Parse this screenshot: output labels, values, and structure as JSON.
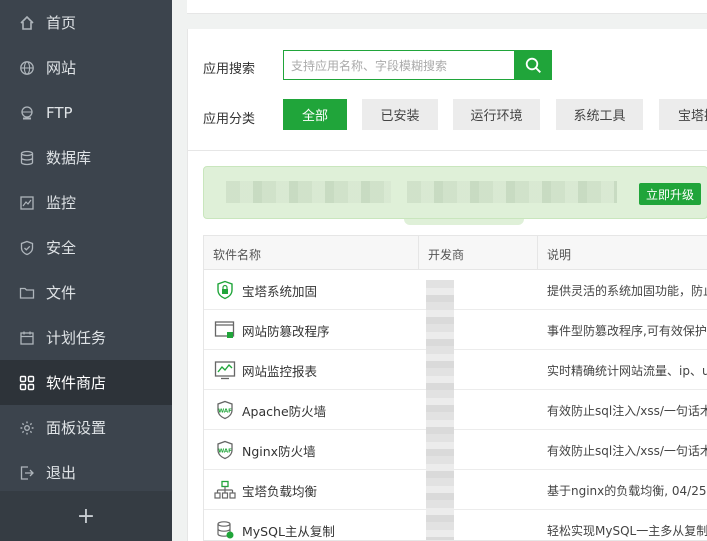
{
  "sidebar": {
    "items": [
      {
        "label": "首页",
        "icon": "home-icon"
      },
      {
        "label": "网站",
        "icon": "globe-icon"
      },
      {
        "label": "FTP",
        "icon": "ftp-icon"
      },
      {
        "label": "数据库",
        "icon": "database-icon"
      },
      {
        "label": "监控",
        "icon": "monitor-icon"
      },
      {
        "label": "安全",
        "icon": "shield-icon"
      },
      {
        "label": "文件",
        "icon": "folder-icon"
      },
      {
        "label": "计划任务",
        "icon": "schedule-icon"
      },
      {
        "label": "软件商店",
        "icon": "grid-icon"
      },
      {
        "label": "面板设置",
        "icon": "gear-icon"
      },
      {
        "label": "退出",
        "icon": "logout-icon"
      }
    ],
    "active_index": 8,
    "add_label": "+"
  },
  "search": {
    "label": "应用搜索",
    "placeholder": "支持应用名称、字段模糊搜索"
  },
  "categories": {
    "label": "应用分类",
    "items": [
      "全部",
      "已安装",
      "运行环境",
      "系统工具",
      "宝塔插"
    ],
    "active_index": 0
  },
  "banner": {
    "upgrade_label": "立即升级"
  },
  "table": {
    "headers": [
      "软件名称",
      "开发商",
      "说明"
    ],
    "rows": [
      {
        "name": "宝塔系统加固",
        "icon": "lock-shield-icon",
        "desc": "提供灵活的系统加固功能，防止"
      },
      {
        "name": "网站防篡改程序",
        "icon": "web-lock-icon",
        "desc": "事件型防篡改程序,可有效保护"
      },
      {
        "name": "网站监控报表",
        "icon": "chart-report-icon",
        "desc": "实时精确统计网站流量、ip、u"
      },
      {
        "name": "Apache防火墙",
        "icon": "waf-shield-icon",
        "desc": "有效防止sql注入/xss/一句话木"
      },
      {
        "name": "Nginx防火墙",
        "icon": "waf-shield-icon",
        "desc": "有效防止sql注入/xss/一句话木"
      },
      {
        "name": "宝塔负载均衡",
        "icon": "load-balance-icon",
        "desc": "基于nginx的负载均衡, 04/25"
      },
      {
        "name": "MySQL主从复制",
        "icon": "database-sync-icon",
        "desc": "轻松实现MySQL一主多从复制"
      }
    ]
  },
  "colors": {
    "accent": "#20a53a",
    "sidebar_bg": "#3c444d",
    "sidebar_active": "#2d3339"
  }
}
